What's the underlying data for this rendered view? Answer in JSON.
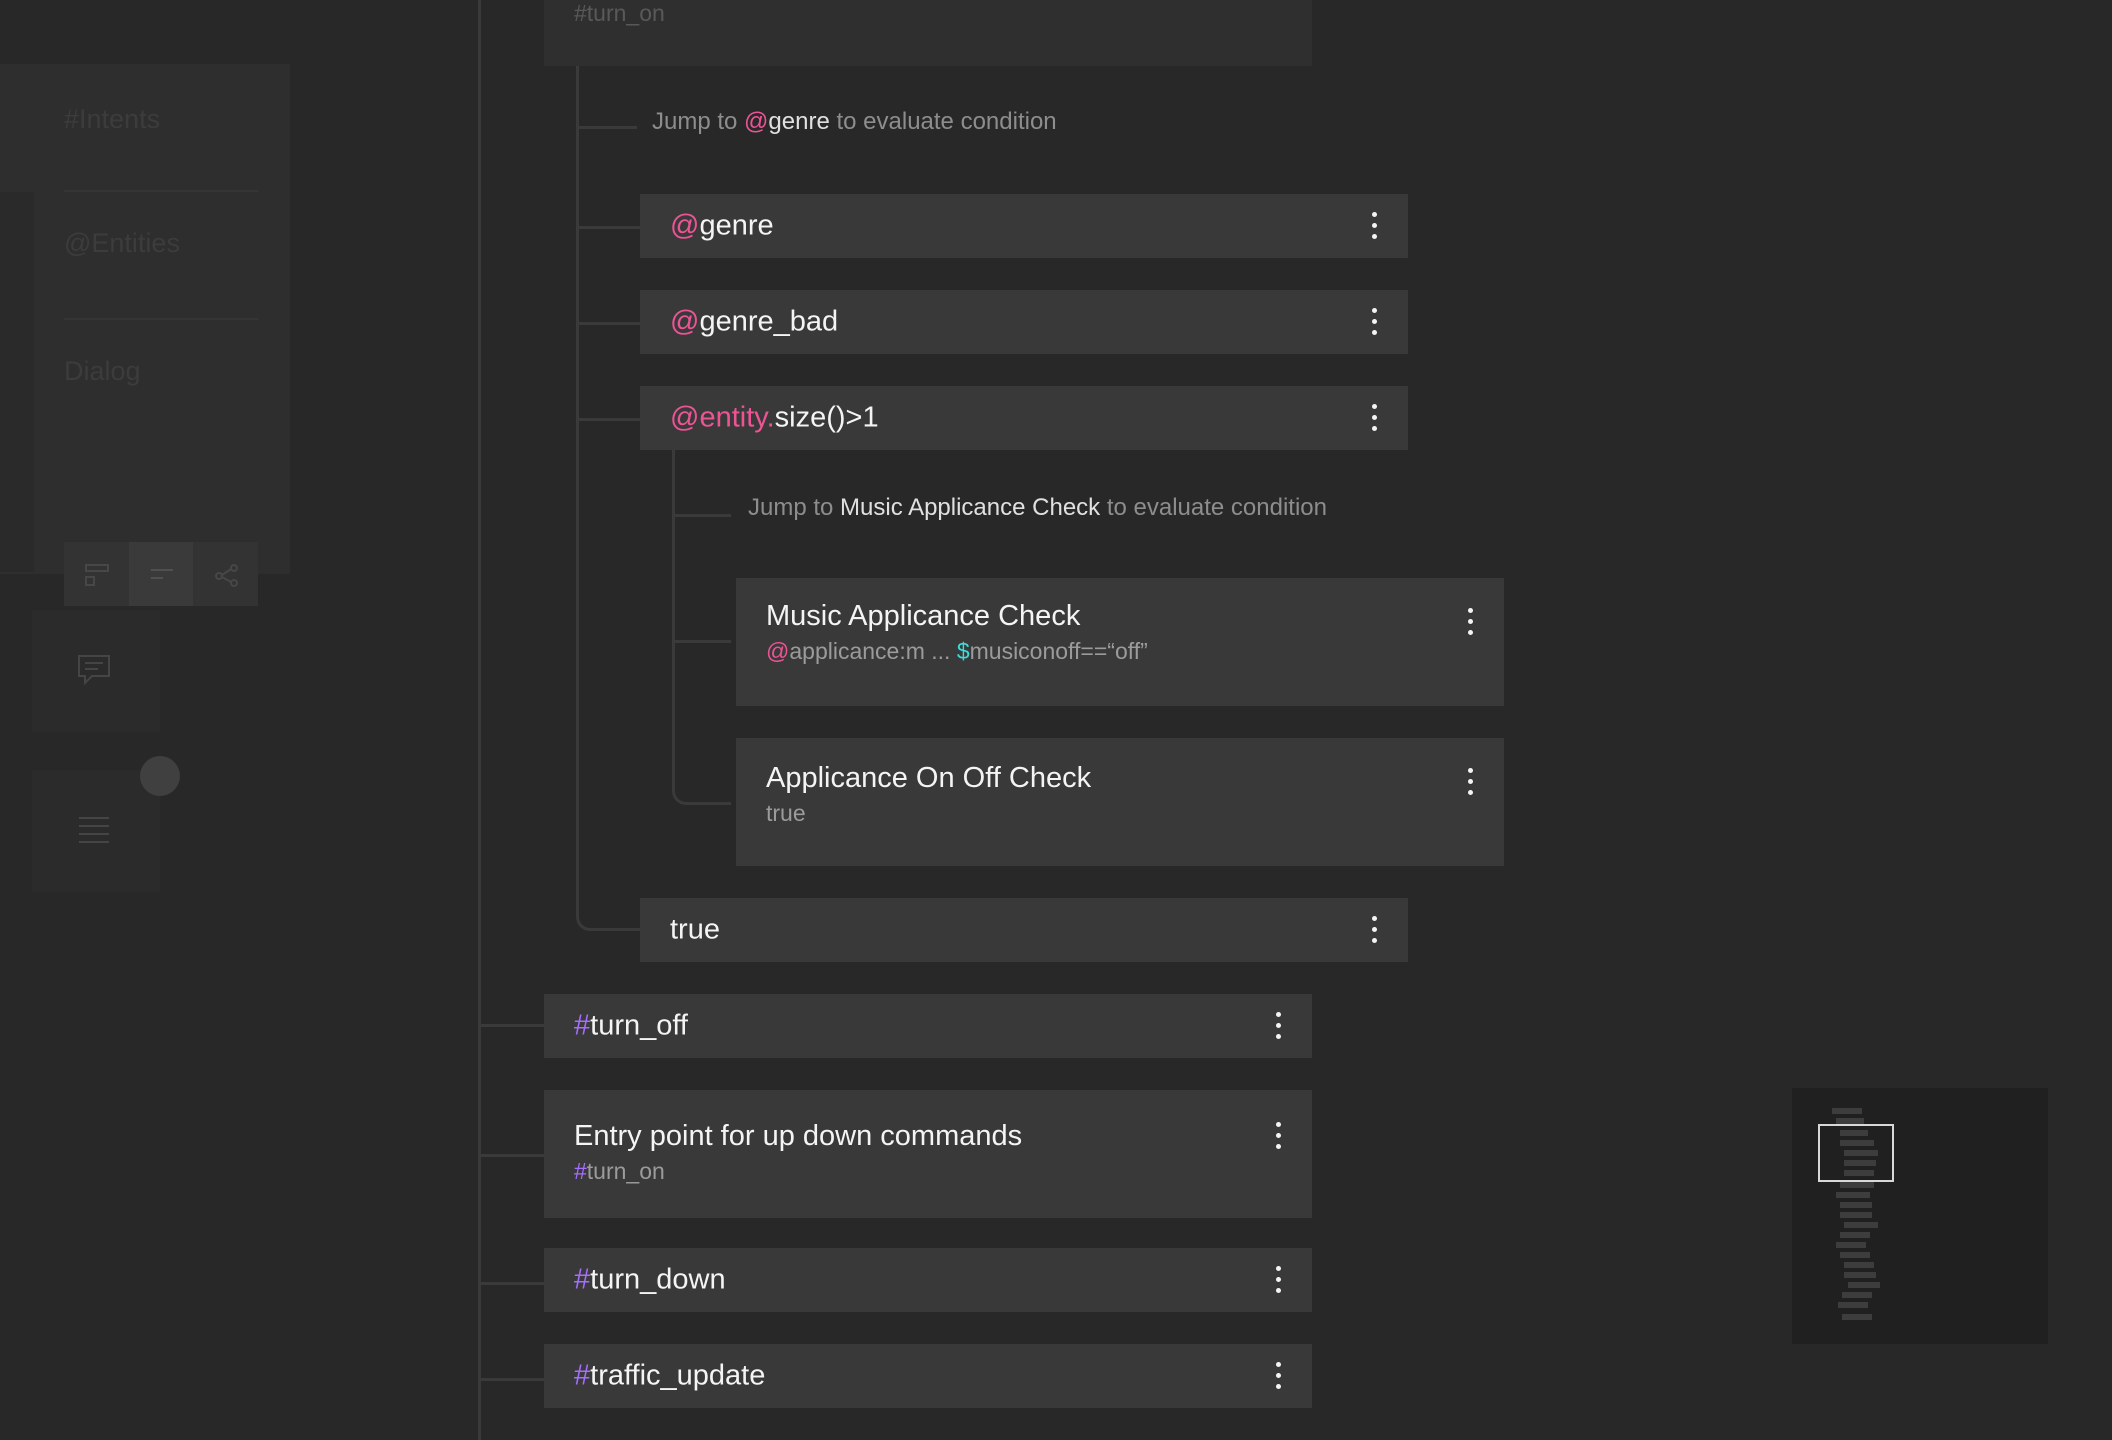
{
  "sidebar": {
    "intents_label": "#Intents",
    "entities_label": "@Entities",
    "dialog_label": "Dialog"
  },
  "tree": {
    "top_partial_condition": "#turn_on",
    "jump_genre": {
      "prefix": "Jump to ",
      "sigil": "@",
      "target": "genre",
      "suffix": " to evaluate condition"
    },
    "genre_node": {
      "sigil": "@",
      "name": "genre"
    },
    "genre_bad_node": {
      "sigil": "@",
      "name": "genre_bad"
    },
    "entity_size_node": {
      "sigil": "@entity.",
      "rest": "size()>1"
    },
    "jump_music": {
      "prefix": "Jump to ",
      "target": "Music Applicance Check",
      "suffix": " to evaluate condition"
    },
    "music_check_node": {
      "title": "Music Applicance Check",
      "cond_at": "@",
      "cond_mid": "applicance:m ... ",
      "cond_dollar": "$",
      "cond_rest": "musiconoff==“off”"
    },
    "onoff_check_node": {
      "title": "Applicance On Off Check",
      "condition": "true"
    },
    "true_node": {
      "label": "true"
    },
    "turn_off_node": {
      "sigil": "#",
      "name": "turn_off"
    },
    "updown_node": {
      "title": "Entry point for up down commands",
      "cond_sigil": "#",
      "cond_name": "turn_on"
    },
    "turn_down_node": {
      "sigil": "#",
      "name": "turn_down"
    },
    "traffic_node": {
      "sigil": "#",
      "name": "traffic_update"
    }
  },
  "icons": {
    "node_menu": "overflow-menu-vertical-icon",
    "chat": "chat-icon",
    "list": "list-icon"
  },
  "colors": {
    "background": "#282828",
    "node": "#393939",
    "intent_hash": "#a56eff",
    "entity_at": "#ee5396",
    "variable_dollar": "#3ddbd9"
  }
}
